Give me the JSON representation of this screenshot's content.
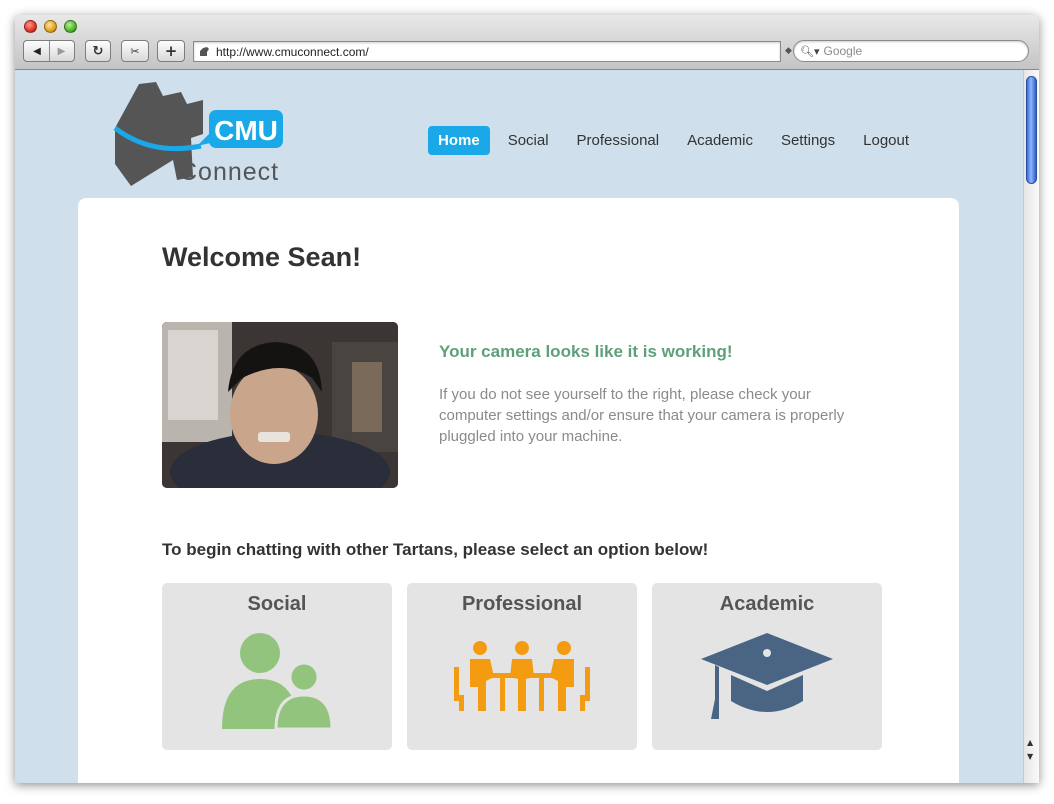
{
  "browser": {
    "url": "http://www.cmuconnect.com/",
    "search_placeholder": "Google"
  },
  "site": {
    "logo_text_top": "CMU",
    "logo_text_bottom": "Connect",
    "nav": [
      {
        "label": "Home",
        "active": true
      },
      {
        "label": "Social",
        "active": false
      },
      {
        "label": "Professional",
        "active": false
      },
      {
        "label": "Academic",
        "active": false
      },
      {
        "label": "Settings",
        "active": false
      },
      {
        "label": "Logout",
        "active": false
      }
    ]
  },
  "main": {
    "welcome": "Welcome Sean!",
    "camera_title": "Your camera looks like it is working!",
    "camera_text": "If you do not see yourself to the right, please check your computer settings and/or ensure that your camera is properly pluggled into your machine.",
    "prompt": "To begin chatting with other Tartans, please select an option below!",
    "options": [
      {
        "label": "Social",
        "icon": "people-icon"
      },
      {
        "label": "Professional",
        "icon": "meeting-icon"
      },
      {
        "label": "Academic",
        "icon": "graduation-cap-icon"
      }
    ]
  },
  "colors": {
    "page_bg": "#cfe0ec",
    "accent_blue": "#1aa8e8",
    "camera_title_green": "#5ea07a",
    "social_green": "#92c47d",
    "professional_orange": "#f39c12",
    "academic_slate": "#4a6584"
  }
}
